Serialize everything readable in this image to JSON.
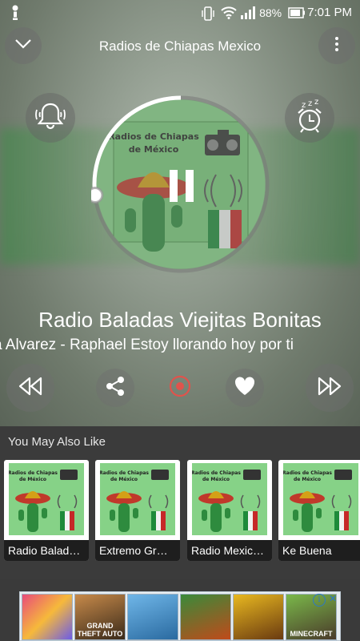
{
  "status_bar": {
    "notification_icon": "exclamation-person-icon",
    "battery_percent": "88%",
    "time": "7:01 PM"
  },
  "header": {
    "title": "Radios de Chiapas Mexico"
  },
  "artwork": {
    "logo_text_line1": "Radios de Chiapas",
    "logo_text_line2": "de México",
    "playback_state_icon": "pause-icon",
    "progress_fraction": 0.27
  },
  "now_playing": {
    "station": "Radio Baladas Viejitas Bonitas",
    "track": "a Alvarez - Raphael Estoy llorando hoy por ti"
  },
  "section_title": "You May Also Like",
  "recommendations": [
    {
      "label": "Radio Balad…"
    },
    {
      "label": "Extremo Gr…"
    },
    {
      "label": "Radio Mexic…"
    },
    {
      "label": "Ke Buena"
    }
  ],
  "ad": {
    "tiles": [
      "",
      "GRAND THEFT AUTO",
      "",
      "",
      "",
      "MINECRAFT"
    ],
    "info": "i",
    "close": "✕"
  },
  "colors": {
    "accent_record": "#e0534c",
    "card_label_bg": "#1e1e1e",
    "section_bg": "#3b3b3b"
  }
}
